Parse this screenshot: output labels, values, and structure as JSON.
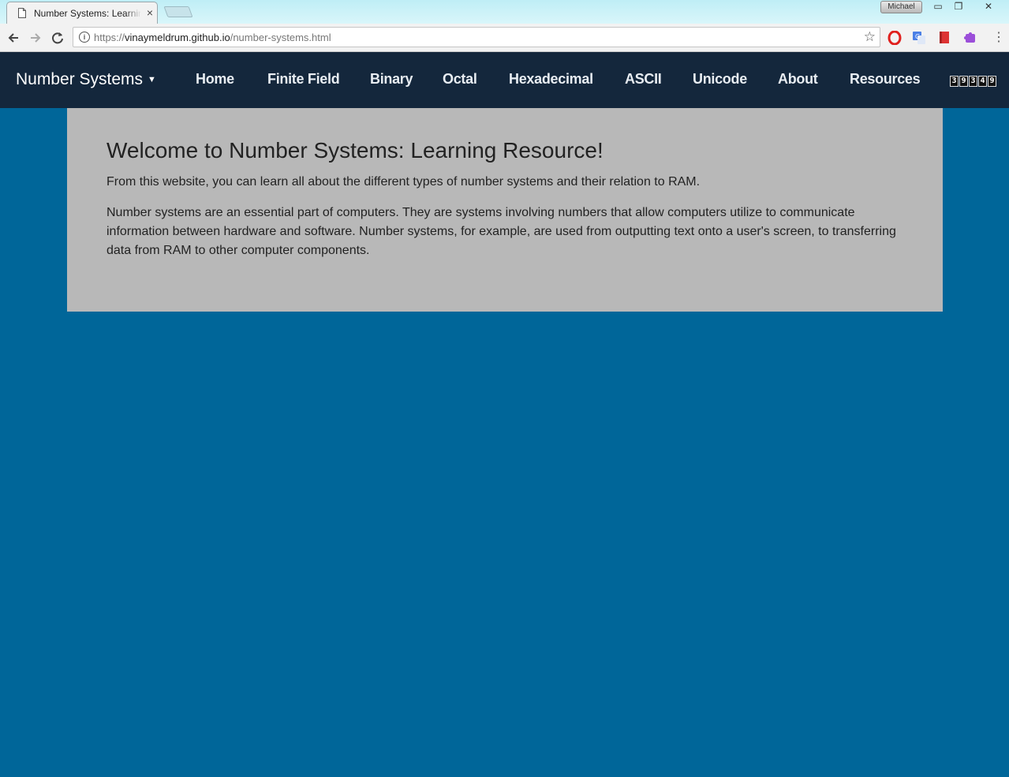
{
  "browser": {
    "tab_title": "Number Systems: Learning Resource!",
    "tab_close": "×",
    "profile_name": "Michael",
    "url_prefix": "https://",
    "url_host": "vinaymeldrum.github.io",
    "url_path": "/number-systems.html",
    "window_controls": {
      "minimize": "▭",
      "restore": "❐",
      "close": "✕"
    }
  },
  "nav": {
    "brand": "Number Systems",
    "brand_caret": "▼",
    "links": [
      "Home",
      "Finite Field",
      "Binary",
      "Octal",
      "Hexadecimal",
      "ASCII",
      "Unicode",
      "About",
      "Resources"
    ],
    "counter_digits": [
      "3",
      "9",
      "3",
      "4",
      "9"
    ]
  },
  "content": {
    "heading": "Welcome to Number Systems: Learning Resource!",
    "intro": "From this website, you can learn all about the different types of number systems and their relation to RAM.",
    "body": "Number systems are an essential part of computers. They are systems involving numbers that allow computers utilize to communicate information between hardware and software. Number systems, for example, are used from outputting text onto a user's screen, to transferring data from RAM to other computer components."
  },
  "icons": {
    "back": "back-arrow-icon",
    "forward": "forward-arrow-icon",
    "reload": "reload-icon",
    "info": "info-icon",
    "bookmark": "star-icon",
    "extensions": [
      "opera-icon",
      "translate-icon",
      "bookmark-red-icon",
      "puzzle-extension-icon"
    ],
    "menu": "kebab-menu-icon"
  },
  "colors": {
    "page_background": "#006699",
    "nav_background": "#14273c",
    "card_background": "#b8b8b8"
  }
}
